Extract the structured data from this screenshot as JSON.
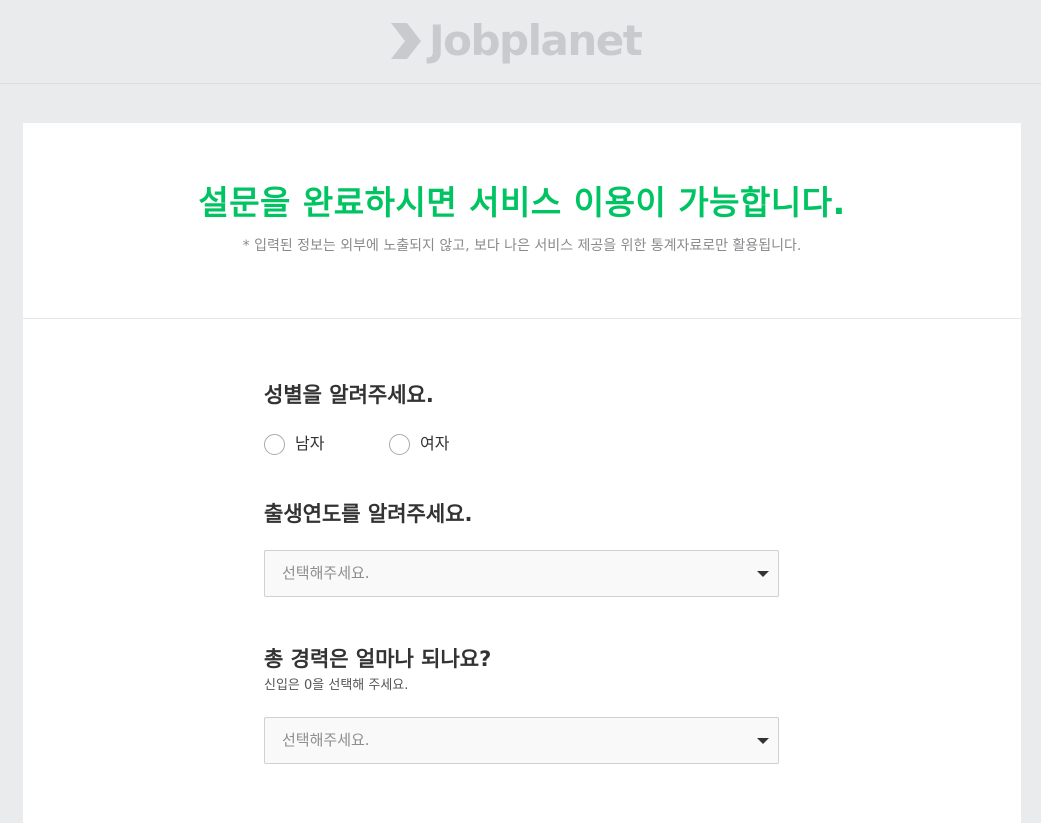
{
  "header": {
    "logo_text": "Jobplanet"
  },
  "intro": {
    "headline": "설문을 완료하시면 서비스 이용이 가능합니다.",
    "note": "* 입력된 정보는 외부에 노출되지 않고, 보다 나은 서비스 제공을 위한 통계자료로만 활용됩니다."
  },
  "questions": {
    "gender": {
      "title": "성별을 알려주세요.",
      "options": [
        "남자",
        "여자"
      ]
    },
    "birth_year": {
      "title": "출생연도를 알려주세요.",
      "placeholder": "선택해주세요."
    },
    "career": {
      "title": "총 경력은 얼마나 되나요?",
      "hint": "신입은 0을 선택해 주세요.",
      "placeholder": "선택해주세요."
    }
  },
  "colors": {
    "accent": "#00c362",
    "background": "#eaebed",
    "logo": "#c9cacd"
  }
}
